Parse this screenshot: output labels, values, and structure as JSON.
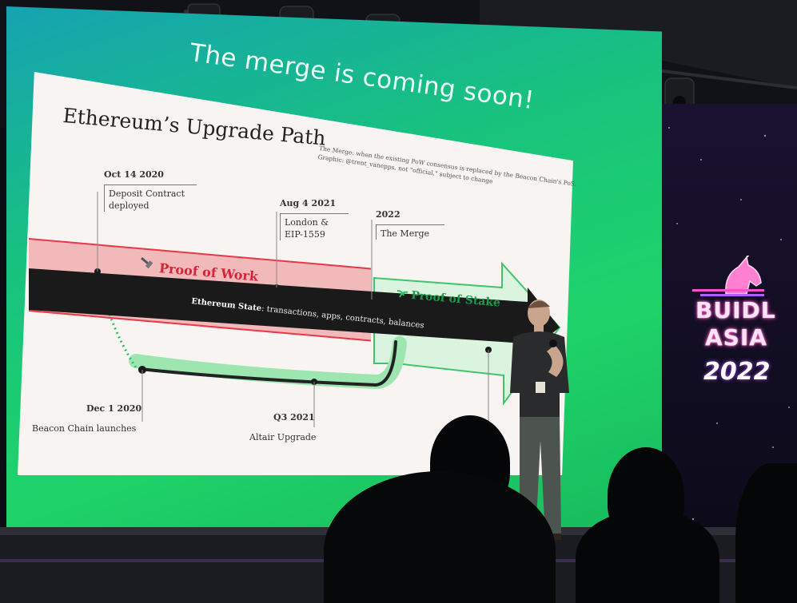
{
  "screen": {
    "headline": "The merge is coming soon!"
  },
  "slide": {
    "title": "Ethereum’s Upgrade Path",
    "note_lines": [
      "The Merge: when the existing PoW consensus is replaced by the Beacon Chain's PoS.",
      "Graphic: @trent_vanepps, not \"official,\" subject to change"
    ],
    "milestones_top": [
      {
        "date": "Oct 14 2020",
        "desc": "Deposit Contract deployed"
      },
      {
        "date": "Aug 4 2021",
        "desc": "London & EIP-1559"
      },
      {
        "date": "2022",
        "desc": "The Merge"
      }
    ],
    "milestones_bottom": [
      {
        "date": "Dec 1 2020",
        "desc": "Beacon Chain launches"
      },
      {
        "date": "Q3 2021",
        "desc": "Altair Upgrade"
      }
    ],
    "pow_label": "Proof of Work",
    "pos_label": "Proof of Stake",
    "state_label_bold": "Ethereum State",
    "state_label_rest": ": transactions, apps, contracts, balances",
    "colors": {
      "pow_red": "#d72438",
      "pos_green": "#1c9a4a",
      "arrow_black": "#1a1a1a"
    }
  },
  "event_logo": {
    "line1": "BUIDL",
    "line2": "ASIA",
    "year": "2022"
  }
}
